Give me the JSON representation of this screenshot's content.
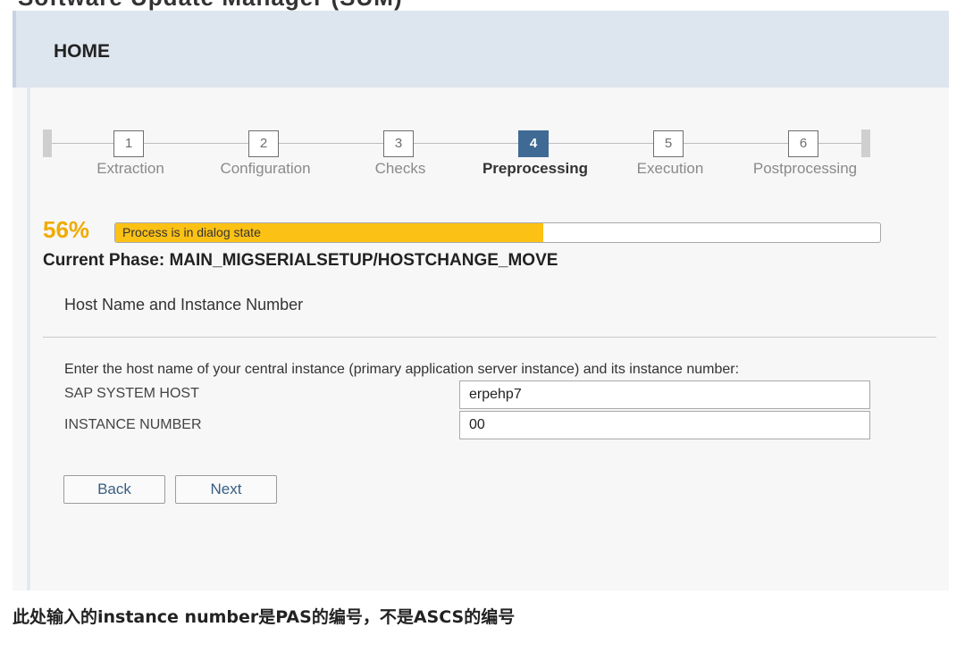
{
  "header": {
    "clipped_title": "Software Update Manager (SUM)",
    "page_title": "HOME"
  },
  "stepper": {
    "active_index": 3,
    "steps": [
      {
        "number": "1",
        "label": "Extraction"
      },
      {
        "number": "2",
        "label": "Configuration"
      },
      {
        "number": "3",
        "label": "Checks"
      },
      {
        "number": "4",
        "label": "Preprocessing"
      },
      {
        "number": "5",
        "label": "Execution"
      },
      {
        "number": "6",
        "label": "Postprocessing"
      }
    ]
  },
  "progress": {
    "percent_label": "56%",
    "percent_value": 56,
    "status_text": "Process is in dialog state",
    "fill_color": "#fcc115",
    "percent_color": "#f0ab00"
  },
  "phase": {
    "current_phase": "Current Phase: MAIN_MIGSERIALSETUP/HOSTCHANGE_MOVE"
  },
  "section": {
    "title": "Host Name and Instance Number",
    "instruction": "Enter the host name of your central instance (primary application server instance) and its instance number:"
  },
  "form": {
    "fields": [
      {
        "label": "SAP SYSTEM HOST",
        "value": "erpehp7"
      },
      {
        "label": "INSTANCE NUMBER",
        "value": "00"
      }
    ]
  },
  "buttons": {
    "back_label": "Back",
    "next_label": "Next"
  },
  "caption": "此处输入的instance number是PAS的编号，不是ASCS的编号",
  "colors": {
    "active_step": "#3f6a94",
    "header_background": "#dde5ee",
    "button_text": "#3a5d85"
  }
}
